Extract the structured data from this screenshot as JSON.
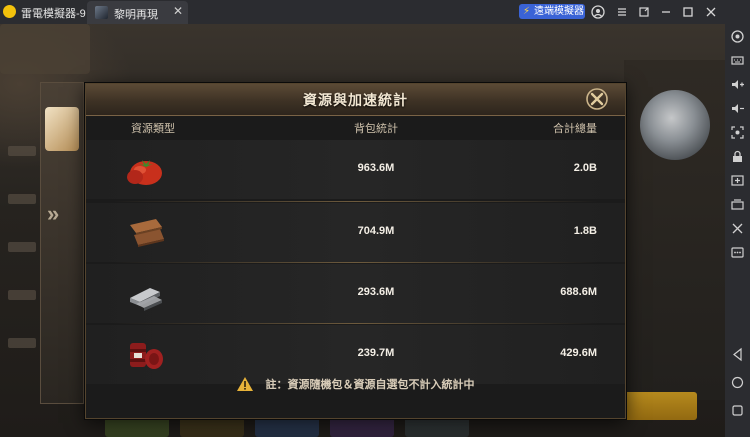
{
  "window": {
    "app_title": "雷電模擬器-9",
    "tab_label": "黎明再現",
    "tab_close": "✕",
    "sync_button_label": "遠端模擬器",
    "controls": [
      "account-icon",
      "menu-icon",
      "restore-icon",
      "minimize-icon",
      "maximize-icon",
      "close-icon"
    ]
  },
  "dialog": {
    "title": "資源與加速統計",
    "columns": {
      "type": "資源類型",
      "bag": "背包統計",
      "total": "合計總量"
    },
    "rows": [
      {
        "icon": "tomato-food-icon",
        "bag": "963.6M",
        "total": "2.0B"
      },
      {
        "icon": "wood-planks-icon",
        "bag": "704.9M",
        "total": "1.8B"
      },
      {
        "icon": "steel-ingot-icon",
        "bag": "293.6M",
        "total": "688.6M"
      },
      {
        "icon": "oil-barrel-icon",
        "bag": "239.7M",
        "total": "429.6M"
      }
    ],
    "footnote": "註：資源隨機包＆資源自選包不計入統計中"
  },
  "side_toolbar": {
    "items": [
      "settings-icon",
      "keyboard-icon",
      "volume-up-icon",
      "volume-down-icon",
      "screenshot-icon",
      "lock-icon",
      "add-window-icon",
      "multi-instance-icon",
      "scissors-icon",
      "more-icon",
      "back-icon",
      "home-icon",
      "recents-icon"
    ]
  },
  "colors": {
    "accent_blue": "#3a63d6",
    "dialog_header": "#4a3c2c",
    "dialog_border": "#54442e"
  }
}
